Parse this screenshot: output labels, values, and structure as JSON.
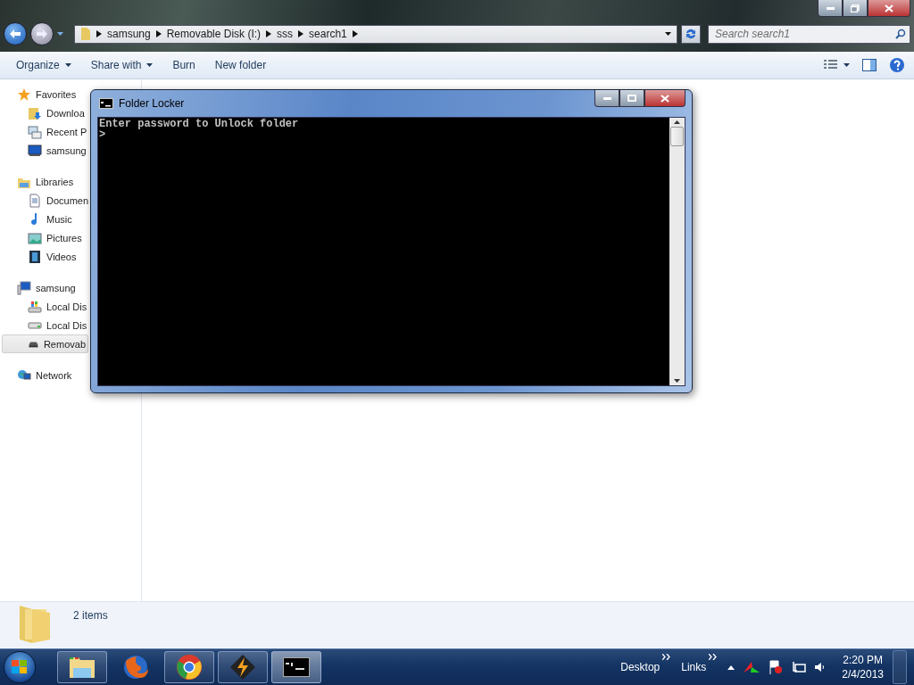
{
  "address_bar": {
    "breadcrumbs": [
      "samsung",
      "Removable Disk (I:)",
      "sss",
      "search1"
    ]
  },
  "search": {
    "placeholder": "Search search1"
  },
  "toolbar": {
    "items": [
      {
        "label": "Organize",
        "dropdown": true
      },
      {
        "label": "Share with",
        "dropdown": true
      },
      {
        "label": "Burn",
        "dropdown": false
      },
      {
        "label": "New folder",
        "dropdown": false
      }
    ]
  },
  "sidebar": {
    "groups": [
      {
        "label": "Favorites",
        "kind": "star",
        "children": [
          {
            "label": "Downloa",
            "kind": "download",
            "selected": false
          },
          {
            "label": "Recent P",
            "kind": "recent",
            "selected": false
          },
          {
            "label": "samsung",
            "kind": "monitor",
            "selected": false
          }
        ]
      },
      {
        "label": "Libraries",
        "kind": "library",
        "children": [
          {
            "label": "Documen",
            "kind": "document",
            "selected": false
          },
          {
            "label": "Music",
            "kind": "music",
            "selected": false
          },
          {
            "label": "Pictures",
            "kind": "picture",
            "selected": false
          },
          {
            "label": "Videos",
            "kind": "video",
            "selected": false
          }
        ]
      },
      {
        "label": "samsung",
        "kind": "computer",
        "children": [
          {
            "label": "Local Dis",
            "kind": "system-drive",
            "selected": false
          },
          {
            "label": "Local Dis",
            "kind": "drive",
            "selected": false
          },
          {
            "label": "Removab",
            "kind": "removable",
            "selected": true
          }
        ]
      },
      {
        "label": "Network",
        "kind": "network"
      }
    ]
  },
  "details": {
    "count": "2 items"
  },
  "console": {
    "title": "Folder Locker",
    "lines": [
      "Enter password to Unlock folder",
      ">"
    ]
  },
  "taskbar": {
    "apps": [
      {
        "kind": "explorer",
        "running": true,
        "selected": false
      },
      {
        "kind": "firefox",
        "running": false,
        "selected": false
      },
      {
        "kind": "chrome",
        "running": true,
        "selected": false
      },
      {
        "kind": "winamp",
        "running": true,
        "selected": false
      },
      {
        "kind": "console",
        "running": true,
        "selected": true
      }
    ],
    "toolbars": [
      "Desktop",
      "Links"
    ],
    "time": "2:20 PM",
    "date": "2/4/2013"
  }
}
